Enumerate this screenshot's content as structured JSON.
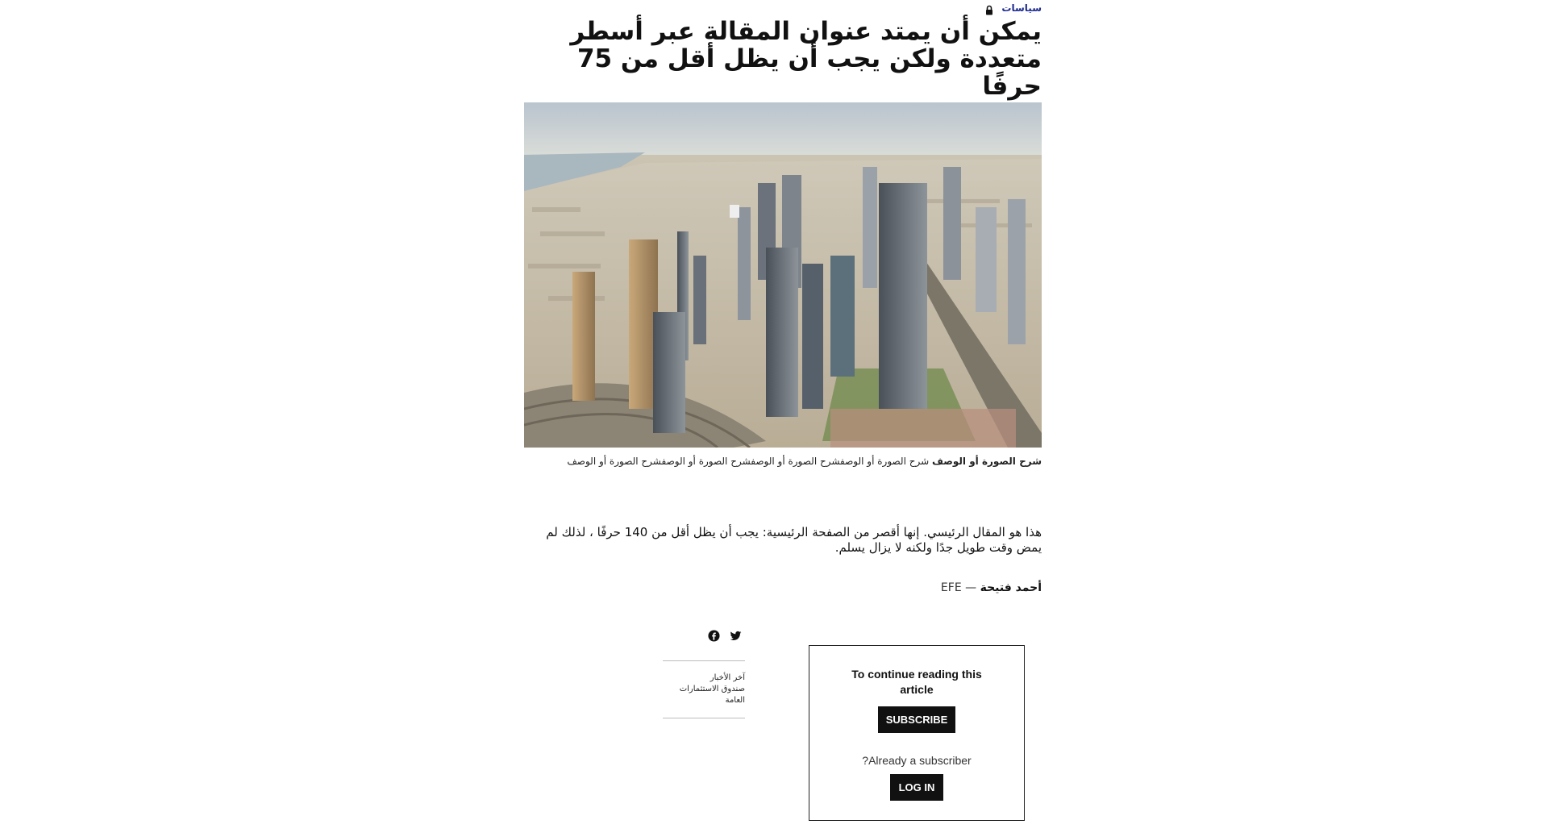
{
  "article": {
    "section": "سياسات",
    "title": "يمكن أن يمتد عنوان المقالة عبر أسطر متعددة ولكن يجب أن يظل أقل من 75 حرفًا",
    "image_caption": {
      "bold": "شرح الصورة أو الوصف",
      "regular": " شرح الصورة أو الوصفشرح الصورة أو الوصفشرح الصورة أو الوصفشرح الصورة أو الوصف"
    },
    "lede": "هذا هو المقال الرئيسي. إنها أقصر من الصفحة الرئيسية: يجب أن يظل أقل من 140 حرفًا ، لذلك لم يمض وقت طويل جدًا ولكنه لا يزال يسلم.",
    "author": "أحمد فتيحة",
    "source": " — EFE"
  },
  "icons": {
    "section_lock": "lock-icon",
    "share_facebook": "facebook-icon",
    "share_twitter": "twitter-icon"
  },
  "related": {
    "heading": "آخر الأخبار",
    "items": [
      "صندوق الاستثمارات",
      "العامة"
    ]
  },
  "paywall": {
    "title": "To continue reading this article",
    "subscribe_label": "SUBSCRIBE",
    "already_subscriber": "?Already a subscriber",
    "login_label": "LOG IN"
  },
  "colors": {
    "section": "#1d2b8f",
    "button_bg": "#111111",
    "button_text": "#ffffff"
  }
}
